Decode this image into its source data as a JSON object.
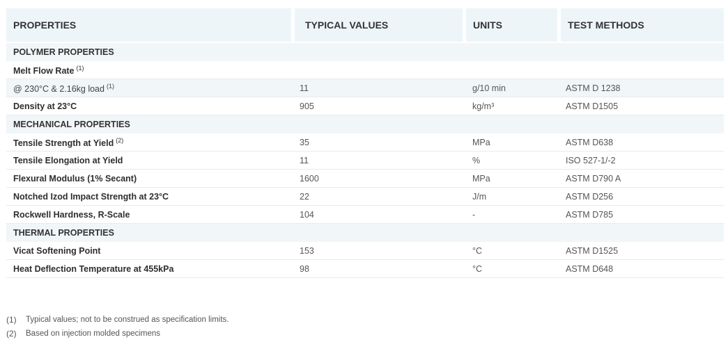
{
  "header": {
    "properties": "PROPERTIES",
    "typical_values": "TYPICAL VALUES",
    "units": "UNITS",
    "test_methods": "TEST METHODS"
  },
  "sections": {
    "polymer": "POLYMER PROPERTIES",
    "mechanical": "MECHANICAL PROPERTIES",
    "thermal": "THERMAL PROPERTIES"
  },
  "rows": {
    "melt_flow": {
      "property": "Melt Flow Rate",
      "note": "(1)"
    },
    "melt_cond": {
      "property": "@ 230°C & 2.16kg load",
      "note": "(1)",
      "value": "11",
      "unit": "g/10 min",
      "method": "ASTM D 1238"
    },
    "density": {
      "property": "Density at 23°C",
      "value": "905",
      "unit": "kg/m³",
      "method": "ASTM D1505"
    },
    "tensile_strength": {
      "property": "Tensile Strength at Yield",
      "note": "(2)",
      "value": "35",
      "unit": "MPa",
      "method": "ASTM D638"
    },
    "tensile_elong": {
      "property": "Tensile Elongation at Yield",
      "value": "11",
      "unit": "%",
      "method": "ISO 527-1/-2"
    },
    "flexural": {
      "property": "Flexural Modulus (1% Secant)",
      "value": "1600",
      "unit": "MPa",
      "method": "ASTM D790 A"
    },
    "izod": {
      "property": "Notched Izod Impact Strength at 23°C",
      "value": "22",
      "unit": "J/m",
      "method": "ASTM D256"
    },
    "rockwell": {
      "property": "Rockwell Hardness, R-Scale",
      "value": "104",
      "unit": "-",
      "method": "ASTM D785"
    },
    "vicat": {
      "property": "Vicat Softening Point",
      "value": "153",
      "unit": "°C",
      "method": "ASTM D1525"
    },
    "hdt": {
      "property": "Heat Deflection Temperature at 455kPa",
      "value": "98",
      "unit": "°C",
      "method": "ASTM D648"
    }
  },
  "footnotes": [
    {
      "num": "(1)",
      "text": "Typical values; not to be construed as specification limits."
    },
    {
      "num": "(2)",
      "text": "Based on injection molded specimens"
    }
  ]
}
